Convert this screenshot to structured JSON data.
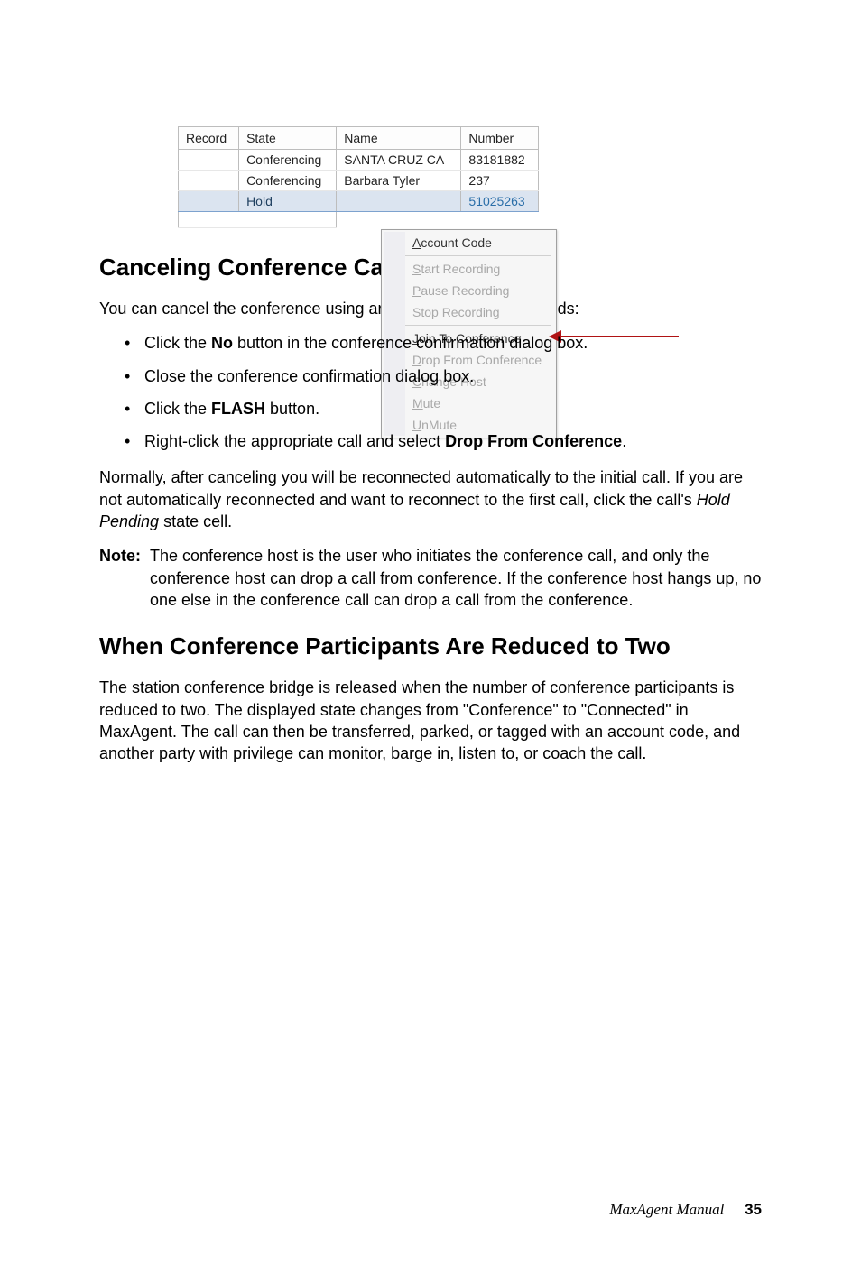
{
  "screenshot": {
    "headers": {
      "record": "Record",
      "state": "State",
      "name": "Name",
      "number": "Number"
    },
    "rows": [
      {
        "record": "",
        "state": "Conferencing",
        "name": "SANTA CRUZ  CA",
        "number": "83181882"
      },
      {
        "record": "",
        "state": "Conferencing",
        "name": "Barbara Tyler",
        "number": "237"
      },
      {
        "record": "",
        "state": "Hold",
        "name": "",
        "number": "51025263",
        "hold": true
      }
    ],
    "menu": {
      "account_code": "Account Code",
      "start_recording": "Start Recording",
      "pause_recording": "Pause Recording",
      "stop_recording": "Stop Recording",
      "join_conf": "Join To Conference",
      "drop_conf": "Drop From Conference",
      "change_host": "Change Host",
      "mute": "Mute",
      "unmute": "UnMute"
    }
  },
  "section1": {
    "heading": "Canceling Conference Calls",
    "intro": "You can cancel the conference using any of the following methods:",
    "bullets": {
      "b1_pre": "Click the ",
      "b1_bold": "No",
      "b1_post": " button in the conference confirmation dialog box.",
      "b2": "Close the conference confirmation dialog box.",
      "b3_pre": "Click the ",
      "b3_bold": "FLASH",
      "b3_post": " button.",
      "b4_pre": "Right-click the appropriate call and select ",
      "b4_bold": "Drop From Conference",
      "b4_post": "."
    },
    "para2_pre": "Normally, after canceling you will be reconnected automatically to the initial call. If you are not automatically reconnected and want to reconnect to the first call, click the call's ",
    "para2_italic": "Hold Pending",
    "para2_post": " state cell.",
    "note_label": "Note:",
    "note_text": "The conference host is the user who initiates the conference call, and only the conference host can drop a call from conference. If the conference host hangs up, no one else in the conference call can drop a call from the conference."
  },
  "section2": {
    "heading": "When Conference Participants Are Reduced to Two",
    "para": "The station conference bridge is released when the number of conference participants is reduced to two. The displayed state changes from \"Conference\" to \"Connected\" in MaxAgent. The call can then be transferred, parked, or tagged with an account code, and another party with privilege can monitor, barge in, listen to, or coach the call."
  },
  "footer": {
    "book": "MaxAgent Manual",
    "page": "35"
  }
}
